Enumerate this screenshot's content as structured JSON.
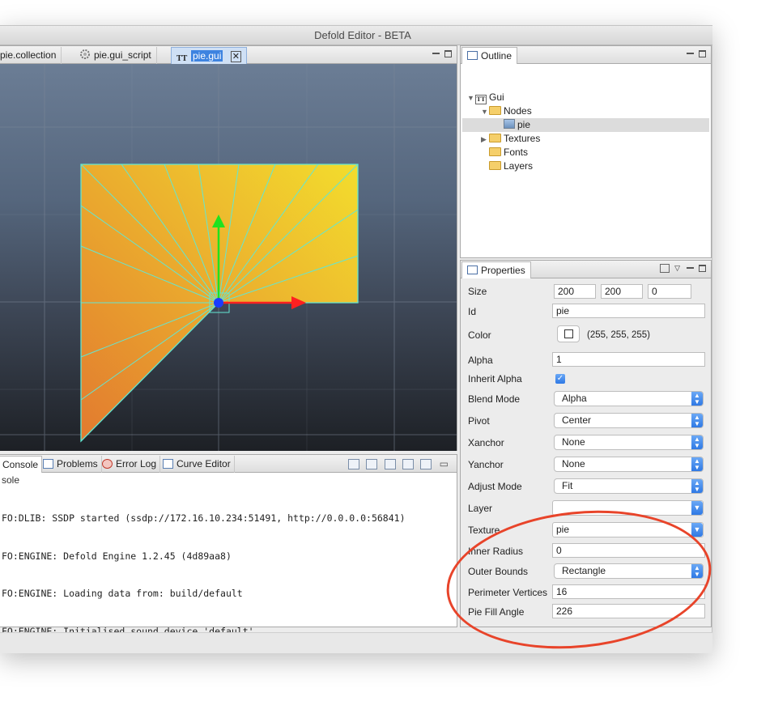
{
  "window": {
    "title": "Defold Editor - BETA"
  },
  "editor": {
    "tabs": [
      {
        "label": "pie.collection"
      },
      {
        "label": "pie.gui_script"
      },
      {
        "label": "pie.gui",
        "active": true
      }
    ]
  },
  "console": {
    "tabs": [
      "Console",
      "Problems",
      "Error Log",
      "Curve Editor"
    ],
    "sublabel": "sole",
    "lines": [
      "FO:DLIB: SSDP started (ssdp://172.16.10.234:51491, http://0.0.0.0:56841)",
      "FO:ENGINE: Defold Engine 1.2.45 (4d89aa8)",
      "FO:ENGINE: Loading data from: build/default",
      "FO:ENGINE: Initialised sound device 'default'"
    ]
  },
  "outline": {
    "tab": "Outline",
    "items": [
      {
        "label": "Gui"
      },
      {
        "label": "Nodes"
      },
      {
        "label": "pie"
      },
      {
        "label": "Textures"
      },
      {
        "label": "Fonts"
      },
      {
        "label": "Layers"
      }
    ]
  },
  "properties": {
    "tab": "Properties",
    "size": {
      "label": "Size",
      "x": "200",
      "y": "200",
      "z": "0"
    },
    "id": {
      "label": "Id",
      "value": "pie"
    },
    "color": {
      "label": "Color",
      "value": "(255, 255, 255)"
    },
    "alpha": {
      "label": "Alpha",
      "value": "1"
    },
    "inherit_alpha": {
      "label": "Inherit Alpha",
      "checked": true
    },
    "blend_mode": {
      "label": "Blend Mode",
      "value": "Alpha"
    },
    "pivot": {
      "label": "Pivot",
      "value": "Center"
    },
    "xanchor": {
      "label": "Xanchor",
      "value": "None"
    },
    "yanchor": {
      "label": "Yanchor",
      "value": "None"
    },
    "adjust_mode": {
      "label": "Adjust Mode",
      "value": "Fit"
    },
    "layer": {
      "label": "Layer",
      "value": ""
    },
    "texture": {
      "label": "Texture",
      "value": "pie"
    },
    "inner_radius": {
      "label": "Inner Radius",
      "value": "0"
    },
    "outer_bounds": {
      "label": "Outer Bounds",
      "value": "Rectangle"
    },
    "perimeter_vertices": {
      "label": "Perimeter Vertices",
      "value": "16"
    },
    "pie_fill_angle": {
      "label": "Pie Fill Angle",
      "value": "226"
    }
  },
  "colors": {
    "annotation": "#e8442a",
    "pie_start": "#e27a2f",
    "pie_end": "#f3dd2d",
    "outline_cyan": "#63e6d2",
    "x_arrow": "#ff2020",
    "y_arrow": "#1fe21f",
    "pivot": "#1a3cff"
  }
}
